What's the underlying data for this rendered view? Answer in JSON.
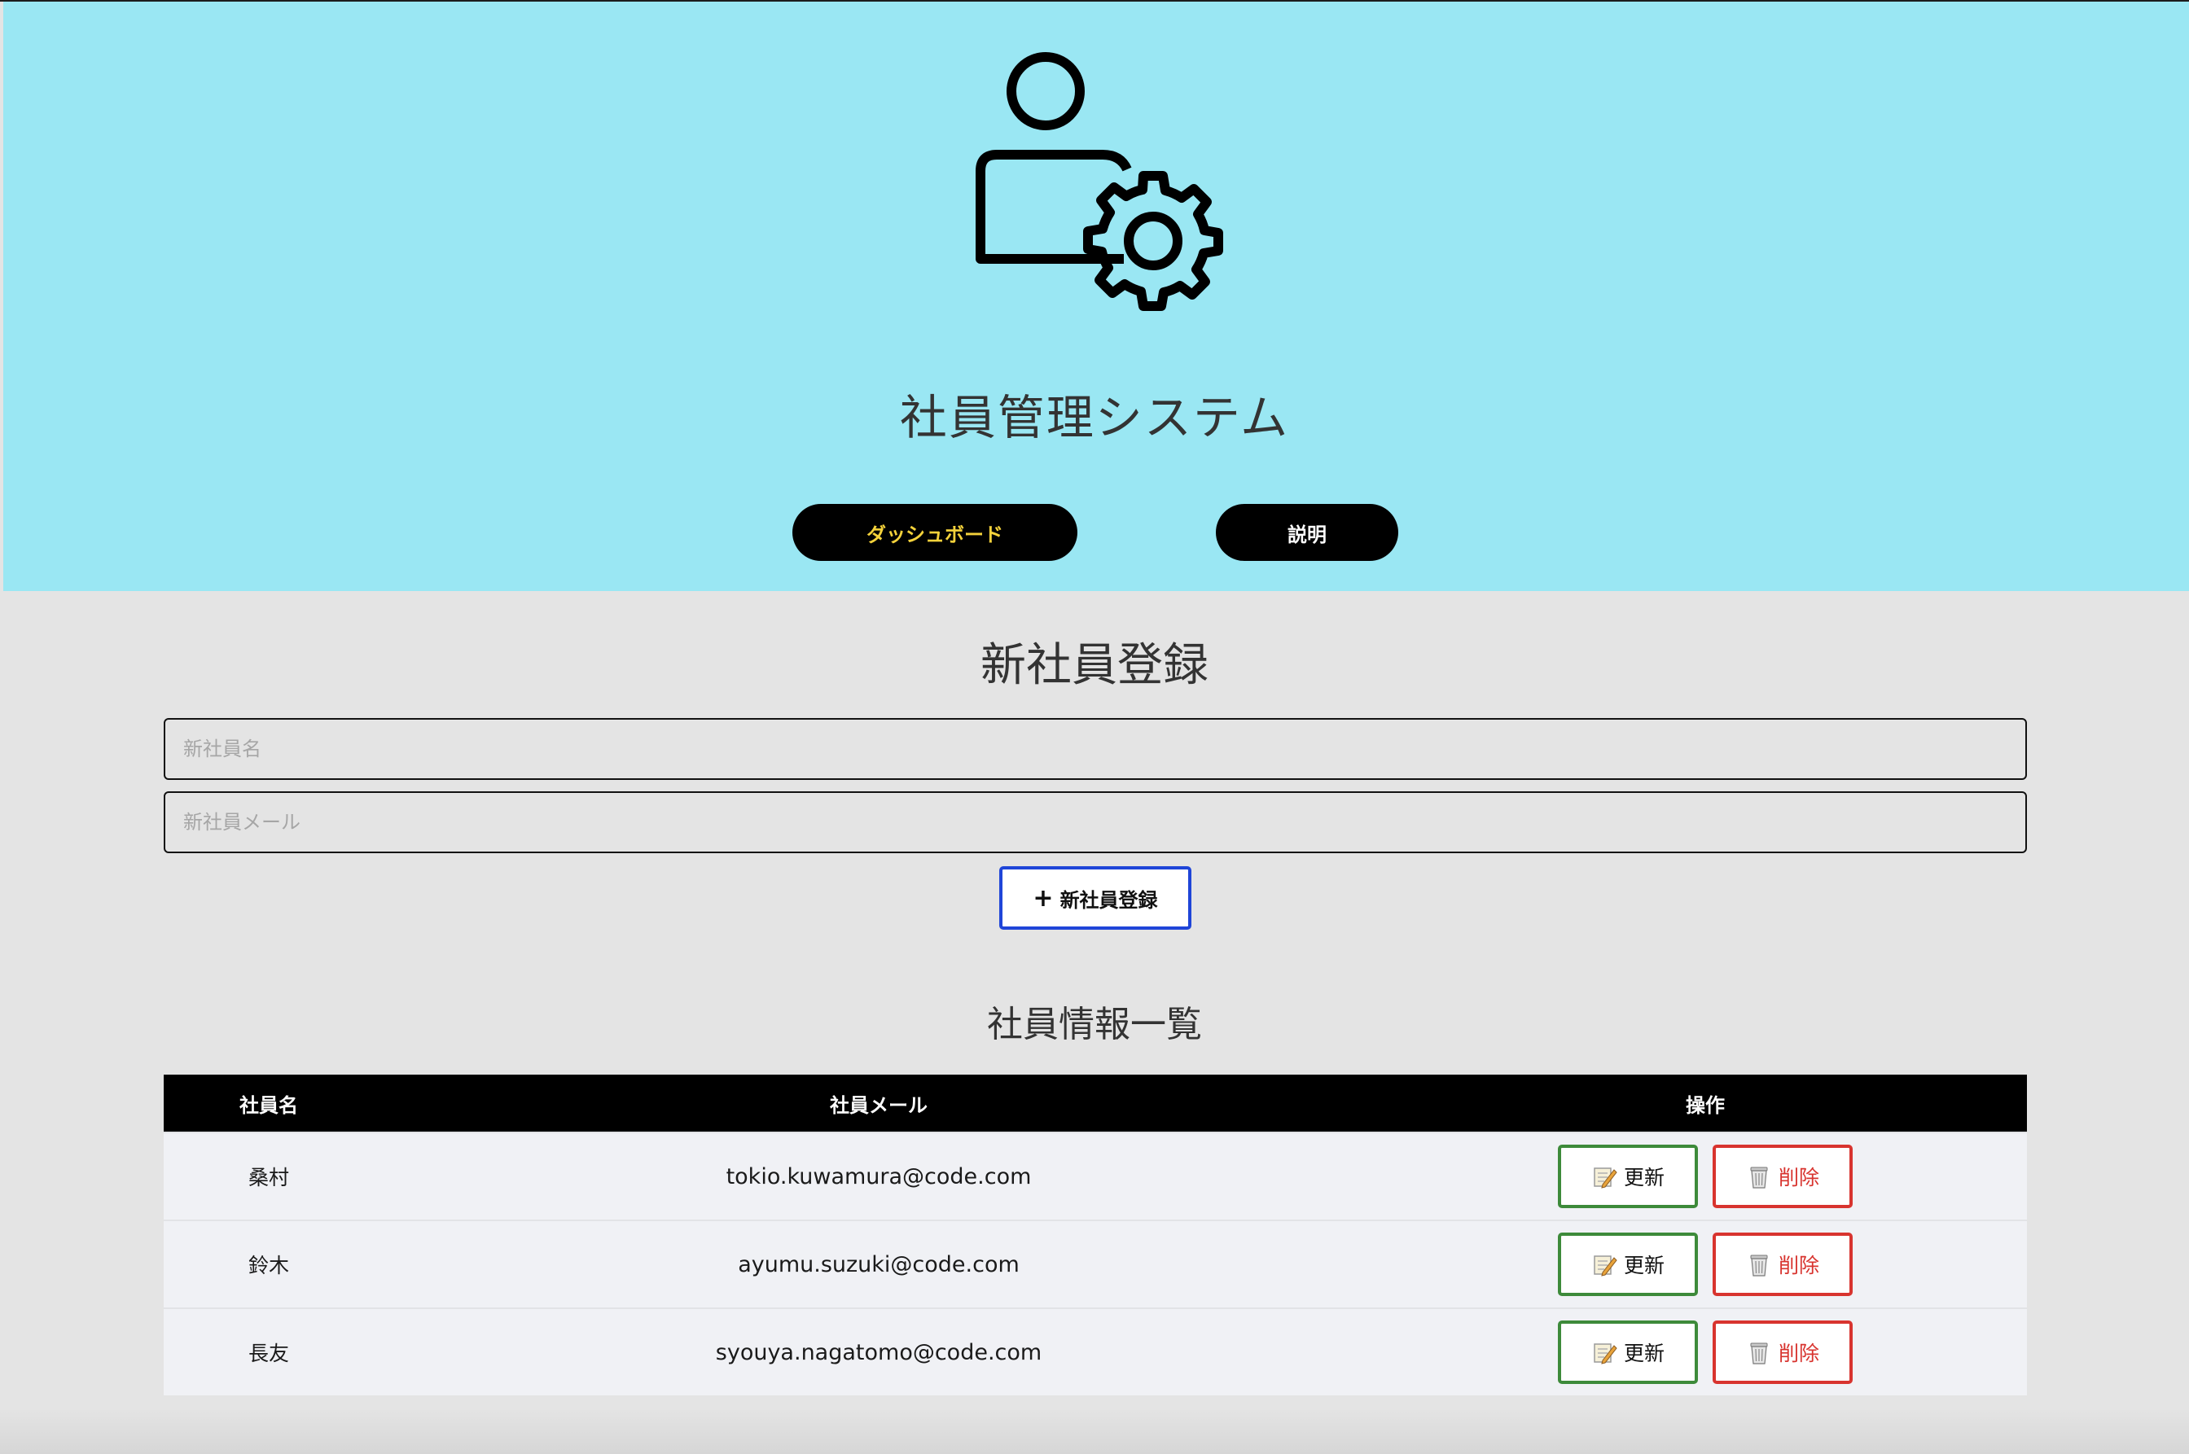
{
  "header": {
    "app_title": "社員管理システム",
    "bg_color": "#9ae7f3",
    "logo_icon": "user-gear-icon",
    "nav": {
      "dashboard_label": "ダッシュボード",
      "explain_label": "説明"
    }
  },
  "register": {
    "title": "新社員登録",
    "name_placeholder": "新社員名",
    "mail_placeholder": "新社員メール",
    "add_button_icon": "+",
    "add_button_label": "新社員登録"
  },
  "list": {
    "title": "社員情報一覧",
    "columns": {
      "name": "社員名",
      "mail": "社員メール",
      "ops": "操作"
    },
    "rows": [
      {
        "name": "桑村",
        "mail": "tokio.kuwamura@code.com"
      },
      {
        "name": "鈴木",
        "mail": "ayumu.suzuki@code.com"
      },
      {
        "name": "長友",
        "mail": "syouya.nagatomo@code.com"
      }
    ],
    "update_label": "更新",
    "update_icon": "memo-pencil-icon",
    "delete_label": "削除",
    "delete_icon": "trash-can-icon"
  },
  "colors": {
    "add_border": "#1f45d8",
    "update_border": "#3d8a3a",
    "delete_border": "#d8342f",
    "dashboard_text": "#f4d23b"
  }
}
